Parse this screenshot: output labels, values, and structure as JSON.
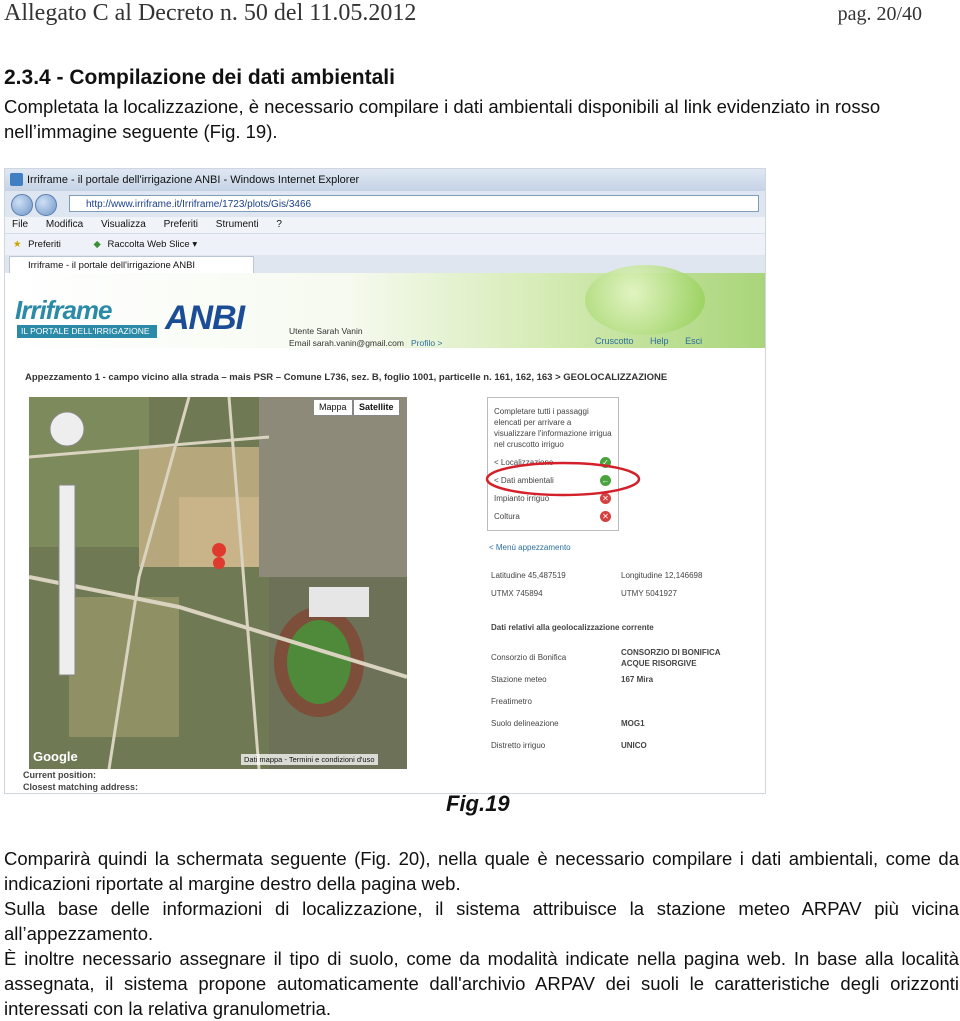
{
  "header": {
    "left": "Allegato C al Decreto n. 50 del 11.05.2012",
    "right": "pag. 20/40"
  },
  "section_title": "2.3.4 - Compilazione dei dati ambientali",
  "intro": "Completata la localizzazione, è necessario compilare i dati ambientali disponibili al link evidenziato in rosso nell’immagine seguente (Fig. 19).",
  "figure": {
    "window_title": "Irriframe - il portale dell'irrigazione ANBI - Windows Internet Explorer",
    "url": "http://www.irriframe.it/Irriframe/1723/plots/Gis/3466",
    "menu": [
      "File",
      "Modifica",
      "Visualizza",
      "Preferiti",
      "Strumenti",
      "?"
    ],
    "favorites": [
      "Preferiti",
      "Raccolta Web Slice ▾"
    ],
    "tab_title": "Irriframe - il portale dell'irrigazione ANBI",
    "logo_text": "Irriframe",
    "logo_sub": "IL PORTALE DELL'IRRIGAZIONE",
    "anbi": "ANBI",
    "user_line1": "Utente Sarah Vanin",
    "user_line2": "Email sarah.vanin@gmail.com",
    "profile": "Profilo >",
    "links": [
      "Cruscotto",
      "Help",
      "Esci"
    ],
    "breadcrumb": "Appezzamento 1 - campo vicino alla strada – mais PSR – Comune L736, sez. B, foglio 1001, particelle n. 161, 162, 163 > GEOLOCALIZZAZIONE",
    "map_buttons": [
      "Mappa",
      "Satellite"
    ],
    "map_google": "Google",
    "map_terms": "Dati mappa - Termini e condizioni d'uso",
    "map_foot1": "Current position:",
    "map_foot2": "Closest matching address:",
    "panel_intro": "Completare tutti i passaggi elencati per arrivare a visualizzare l'informazione irrigua nel cruscotto irriguo",
    "steps": [
      "< Localizzazione",
      "< Dati ambientali",
      "Impianto irriguo",
      "Coltura"
    ],
    "menu_link": "< Menù appezzamento",
    "lat_label": "Latitudine 45,487519",
    "lon_label": "Longitudine 12,146698",
    "utmx": "UTMX 745894",
    "utmy": "UTMY 5041927",
    "geo_title": "Dati relativi alla geolocalizzazione corrente",
    "geo_rows": [
      {
        "label": "Consorzio di Bonifica",
        "value": "CONSORZIO DI BONIFICA ACQUE RISORGIVE"
      },
      {
        "label": "Stazione meteo",
        "value": "167 Mira"
      },
      {
        "label": "Freatimetro",
        "value": ""
      },
      {
        "label": "Suolo delineazione",
        "value": "MOG1"
      },
      {
        "label": "Distretto irriguo",
        "value": "UNICO"
      }
    ]
  },
  "fig_caption": "Fig.19",
  "paragraphs": [
    "Comparirà quindi la schermata seguente (Fig. 20), nella quale è necessario compilare i dati ambientali, come da indicazioni riportate al margine destro della pagina web.",
    "Sulla base delle informazioni di localizzazione, il sistema attribuisce la stazione meteo ARPAV più vicina all’appezzamento.",
    "È inoltre necessario assegnare il tipo di suolo, come da modalità indicate nella pagina web. In base alla località assegnata, il sistema propone automaticamente dall'archivio ARPAV dei suoli le caratteristiche degli orizzonti interessati con la relativa granulometria."
  ]
}
